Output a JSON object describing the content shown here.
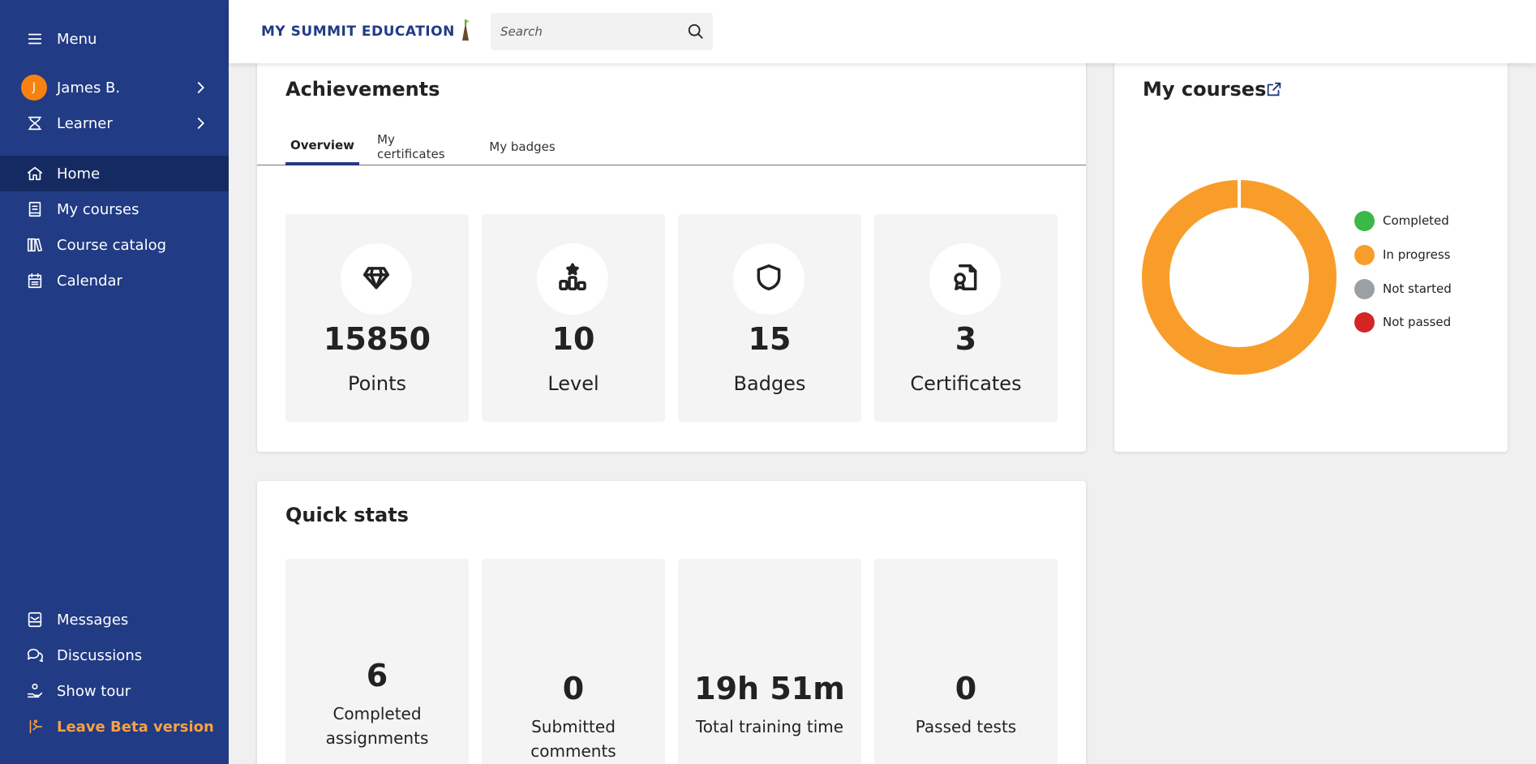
{
  "sidebar": {
    "menu_label": "Menu",
    "user_initial": "J",
    "user_name": "James B.",
    "role": "Learner",
    "nav": [
      {
        "label": "Home",
        "icon": "home-icon"
      },
      {
        "label": "My courses",
        "icon": "book-icon"
      },
      {
        "label": "Course catalog",
        "icon": "catalog-icon"
      },
      {
        "label": "Calendar",
        "icon": "calendar-icon"
      }
    ],
    "bottom": [
      {
        "label": "Messages",
        "icon": "inbox-icon"
      },
      {
        "label": "Discussions",
        "icon": "chat-icon"
      },
      {
        "label": "Show tour",
        "icon": "hand-icon"
      },
      {
        "label": "Leave Beta version",
        "icon": "exit-icon"
      }
    ],
    "active_color": "#162a62",
    "background": "#213b84",
    "beta_color": "#f7a043"
  },
  "header": {
    "logo_text": "MY SUMMIT EDUCATION",
    "search_placeholder": "Search"
  },
  "achievements": {
    "title": "Achievements",
    "tabs": [
      {
        "label": "Overview",
        "active": true
      },
      {
        "label": "My certificates",
        "active": false
      },
      {
        "label": "My badges",
        "active": false
      }
    ],
    "stats": [
      {
        "value": "15850",
        "label": "Points",
        "icon": "diamond-icon"
      },
      {
        "value": "10",
        "label": "Level",
        "icon": "podium-icon"
      },
      {
        "value": "15",
        "label": "Badges",
        "icon": "shield-icon"
      },
      {
        "value": "3",
        "label": "Certificates",
        "icon": "certificate-icon"
      }
    ]
  },
  "quick_stats": {
    "title": "Quick stats",
    "items": [
      {
        "value": "6",
        "label": "Completed assignments"
      },
      {
        "value": "0",
        "label": "Submitted comments"
      },
      {
        "value": "19h 51m",
        "label": "Total training time"
      },
      {
        "value": "0",
        "label": "Passed tests"
      }
    ]
  },
  "my_courses": {
    "title": "My courses",
    "legend": [
      {
        "label": "Completed",
        "color": "#3cb846"
      },
      {
        "label": "In progress",
        "color": "#f99d2a"
      },
      {
        "label": "Not started",
        "color": "#9aa0a3"
      },
      {
        "label": "Not passed",
        "color": "#d42424"
      }
    ],
    "chart_data": {
      "type": "pie",
      "categories": [
        "Completed",
        "In progress",
        "Not started",
        "Not passed"
      ],
      "values": [
        0,
        1,
        0,
        0
      ],
      "colors": [
        "#3cb846",
        "#f99d2a",
        "#9aa0a3",
        "#d42424"
      ]
    }
  }
}
